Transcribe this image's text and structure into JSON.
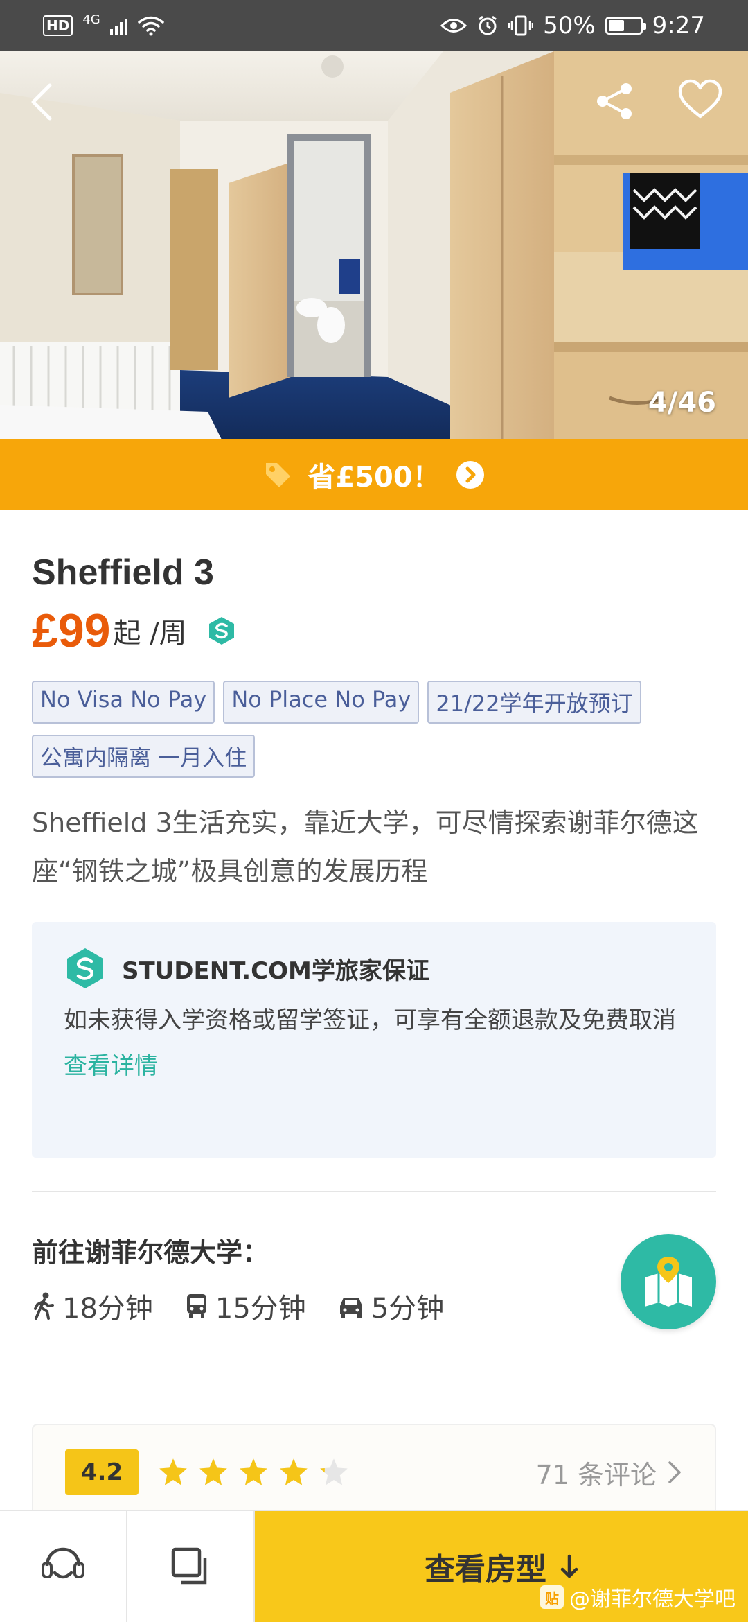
{
  "status_bar": {
    "hd": "HD",
    "network": "4G",
    "battery": "50%",
    "battery_level": 0.5,
    "time": "9:27",
    "icons": [
      "eye-icon",
      "alarm-icon",
      "vibrate-icon",
      "wifi-icon",
      "signal-icon",
      "battery-icon"
    ]
  },
  "hero": {
    "photo_counter": "4/46",
    "icons": [
      "back-arrow-icon",
      "share-icon",
      "heart-icon"
    ]
  },
  "promo": {
    "text": "省£500！",
    "icons": [
      "tag-icon",
      "chevron-right-icon"
    ]
  },
  "listing": {
    "title": "Sheffield 3",
    "price": "£99",
    "price_unit": "起 /周",
    "tags": [
      "No Visa No Pay",
      "No Place No Pay",
      "21/22学年开放预订",
      "公寓内隔离 一月入住"
    ],
    "description": "Sheffield 3生活充实，靠近大学，可尽情探索谢菲尔德这座“钢铁之城”极具创意的发展历程"
  },
  "guarantee": {
    "title": "STUDENT.COM学旅家保证",
    "body": "如未获得入学资格或留学签证，可享有全额退款及免费取消",
    "link": "查看详情"
  },
  "commute": {
    "title": "前往谢菲尔德大学：",
    "walk": "18分钟",
    "bus": "15分钟",
    "car": "5分钟"
  },
  "rating": {
    "score": "4.2",
    "stars": 4.2,
    "reviews": "71 条评论"
  },
  "bottom_bar": {
    "cta": "查看房型",
    "icons": [
      "customer-service-icon",
      "compare-icon",
      "arrow-down-icon"
    ]
  },
  "watermark": {
    "logo": "贴",
    "text": "@谢菲尔德大学吧"
  },
  "colors": {
    "promo": "#f7a60a",
    "price": "#e95b0a",
    "teal": "#2ebaa5",
    "cta": "#f8c81a",
    "star": "#f5c518"
  }
}
